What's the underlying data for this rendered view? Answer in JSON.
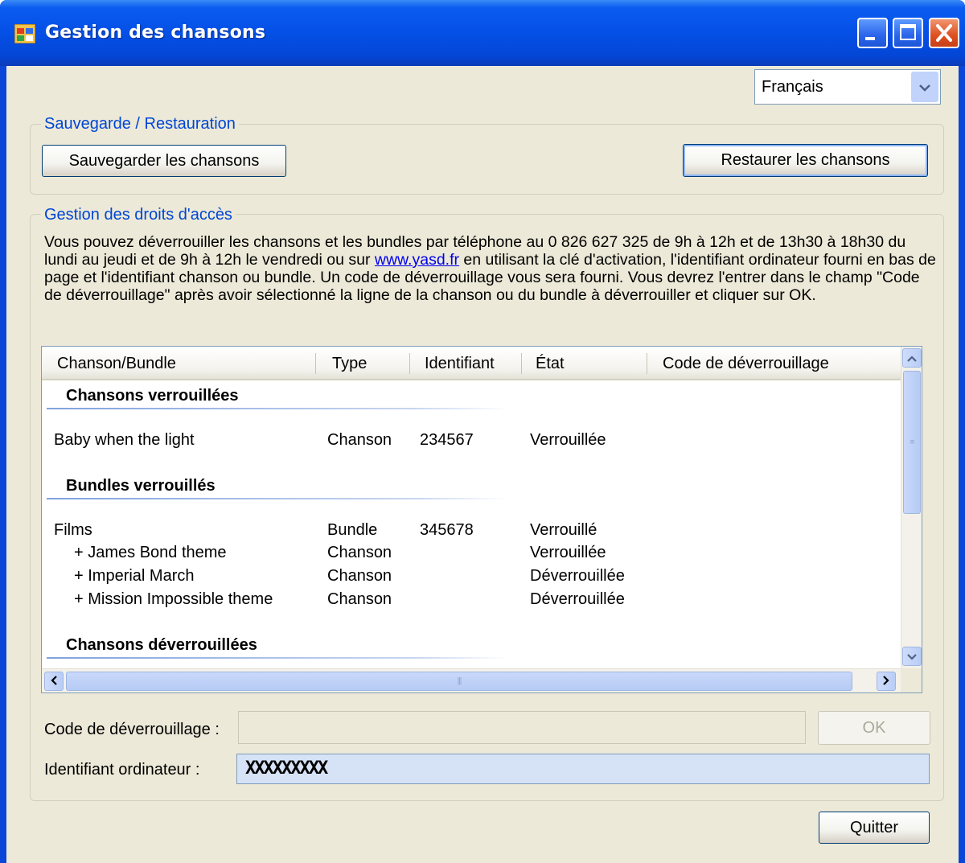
{
  "window": {
    "title": "Gestion des chansons"
  },
  "language_select": {
    "value": "Français"
  },
  "backup_group": {
    "legend": "Sauvegarde / Restauration",
    "save_button": "Sauvegarder les chansons",
    "restore_button": "Restaurer les chansons"
  },
  "access_group": {
    "legend": "Gestion des droits d'accès",
    "info_before_link": "Vous pouvez déverrouiller les chansons et les bundles par téléphone au 0 826 627 325 de 9h à 12h et de 13h30 à 18h30 du lundi au jeudi et de 9h à 12h le vendredi ou sur ",
    "info_link": "www.yasd.fr",
    "info_after_link": " en utilisant la clé d'activation, l'identifiant ordinateur fourni en bas de page et l'identifiant chanson ou bundle. Un code de déverrouillage vous sera fourni. Vous devrez l'entrer dans le champ \"Code de déverrouillage\" après avoir sélectionné la ligne de la chanson ou du bundle à déverrouiller et cliquer sur OK."
  },
  "list": {
    "columns": [
      "Chanson/Bundle",
      "Type",
      "Identifiant",
      "État",
      "Code de déverrouillage"
    ],
    "groups": [
      {
        "title": "Chansons verrouillées",
        "rows": [
          {
            "name": "Baby when the light",
            "type": "Chanson",
            "id": "234567",
            "state": "Verrouillée"
          }
        ]
      },
      {
        "title": "Bundles verrouillés",
        "rows": [
          {
            "name": "Films",
            "type": "Bundle",
            "id": "345678",
            "state": "Verrouillé"
          },
          {
            "name": "+ James Bond theme",
            "type": "Chanson",
            "id": "",
            "state": "Verrouillée"
          },
          {
            "name": "+ Imperial March",
            "type": "Chanson",
            "id": "",
            "state": "Déverrouillée"
          },
          {
            "name": "+ Mission Impossible theme",
            "type": "Chanson",
            "id": "",
            "state": "Déverrouillée"
          }
        ]
      },
      {
        "title": "Chansons déverrouillées",
        "rows": []
      }
    ]
  },
  "unlock": {
    "label": "Code de déverrouillage :",
    "value": "",
    "ok_button": "OK"
  },
  "computer_id": {
    "label": "Identifiant ordinateur :",
    "value": "XXXXXXXXX"
  },
  "quit_button": "Quitter",
  "icons": {
    "app": "app-window-icon",
    "minimize": "minimize-icon",
    "maximize": "maximize-icon",
    "close": "close-icon",
    "dropdown": "chevron-down-icon",
    "scroll_up": "scroll-up-arrow-icon",
    "scroll_down": "scroll-down-arrow-icon",
    "scroll_left": "scroll-left-arrow-icon",
    "scroll_right": "scroll-right-arrow-icon"
  },
  "colors": {
    "title_bar": "#0550e6",
    "close_button": "#dd4f20",
    "group_legend": "#0046d5",
    "form_bg": "#ece9d8",
    "readonly_field": "#d6e2f6"
  }
}
